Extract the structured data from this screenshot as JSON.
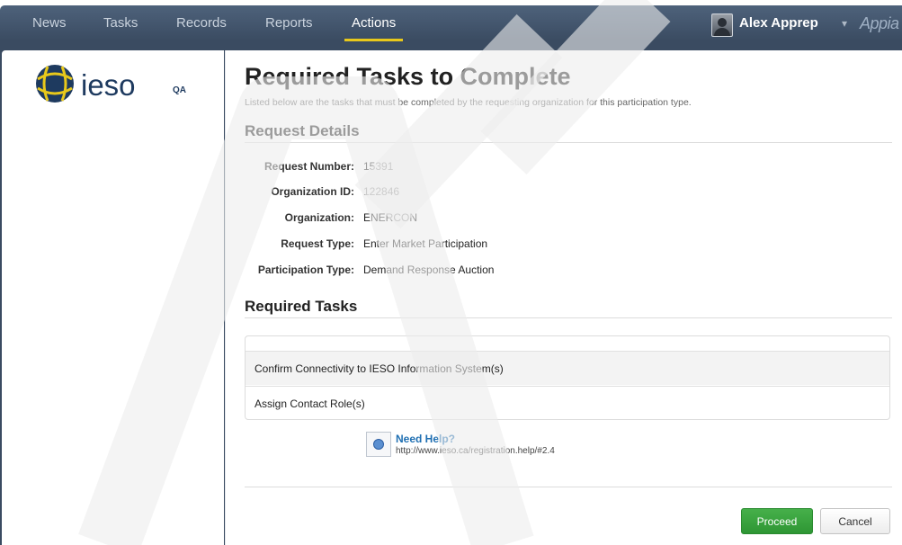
{
  "nav": {
    "items": [
      "News",
      "Tasks",
      "Records",
      "Reports",
      "Actions"
    ],
    "active": "Actions",
    "user_name": "Alex Apprep",
    "user_caret": "▾",
    "brand": "Appia"
  },
  "logo": {
    "text": "ieso",
    "badge": "QA"
  },
  "page": {
    "title": "Required Tasks to Complete",
    "subtitle": "Listed below are the tasks that must be completed by the requesting organization for this participation type."
  },
  "request_details": {
    "heading": "Request Details",
    "fields": [
      {
        "label": "Request Number:",
        "value": "15391"
      },
      {
        "label": "Organization ID:",
        "value": "122846"
      },
      {
        "label": "Organization:",
        "value": "ENERCON"
      },
      {
        "label": "Request Type:",
        "value": "Enter Market Participation"
      },
      {
        "label": "Participation Type:",
        "value": "Demand Response Auction"
      }
    ]
  },
  "required_tasks": {
    "heading": "Required Tasks",
    "rows": [
      "",
      "Confirm Connectivity to IESO Information System(s)",
      "Assign Contact Role(s)"
    ]
  },
  "help": {
    "title": "Need Help?",
    "url": "http://www.ieso.ca/registration.help/#2.4"
  },
  "buttons": {
    "proceed": "Proceed",
    "cancel": "Cancel"
  },
  "colors": {
    "nav_bg": "#3a4b61",
    "active_underline": "#e8c81b",
    "proceed_green": "#2e9634",
    "link_blue": "#1f6fb2"
  }
}
